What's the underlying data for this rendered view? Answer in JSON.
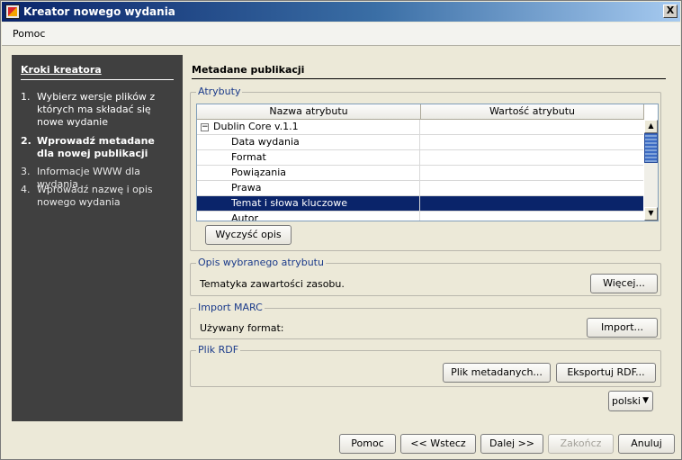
{
  "window": {
    "title": "Kreator nowego wydania",
    "close_glyph": "X"
  },
  "menu": {
    "help": "Pomoc"
  },
  "steps": {
    "title": "Kroki kreatora",
    "items": [
      {
        "num": "1.",
        "label": "Wybierz wersje plików z których ma składać się nowe wydanie",
        "state": "done"
      },
      {
        "num": "2.",
        "label": "Wprowadź metadane dla nowej publikacji",
        "state": "active"
      },
      {
        "num": "3.",
        "label": "Informacje WWW dla wydania",
        "state": "inactive"
      },
      {
        "num": "4.",
        "label": "Wprowadź nazwę i opis nowego wydania",
        "state": "inactive"
      }
    ]
  },
  "main": {
    "title": "Metadane publikacji",
    "attributes": {
      "legend": "Atrybuty",
      "columns": [
        "Nazwa atrybutu",
        "Wartość atrybutu"
      ],
      "rows": [
        {
          "name": "Dublin Core v.1.1",
          "value": "",
          "expander": "−"
        },
        {
          "name": "Data wydania",
          "value": ""
        },
        {
          "name": "Format",
          "value": ""
        },
        {
          "name": "Powiązania",
          "value": ""
        },
        {
          "name": "Prawa",
          "value": ""
        },
        {
          "name": "Temat i słowa kluczowe",
          "value": "",
          "selected": true
        },
        {
          "name": "Autor",
          "value": ""
        }
      ],
      "clear_button": "Wyczyść opis"
    },
    "description": {
      "legend": "Opis wybranego atrybutu",
      "text": "Tematyka zawartości zasobu.",
      "more_button": "Więcej..."
    },
    "marc": {
      "legend": "Import MARC",
      "format_label": "Używany format:",
      "import_button": "Import..."
    },
    "rdf": {
      "legend": "Plik RDF",
      "metadata_button": "Plik metadanych...",
      "export_button": "Eksportuj RDF..."
    },
    "language": {
      "selected": "polski"
    }
  },
  "footer": {
    "help": "Pomoc",
    "back": "<< Wstecz",
    "next": "Dalej >>",
    "finish": "Zakończ",
    "cancel": "Anuluj"
  },
  "colors": {
    "accent": "#0a246a",
    "sidebar": "#404040",
    "group_label": "#1a3a8a"
  }
}
